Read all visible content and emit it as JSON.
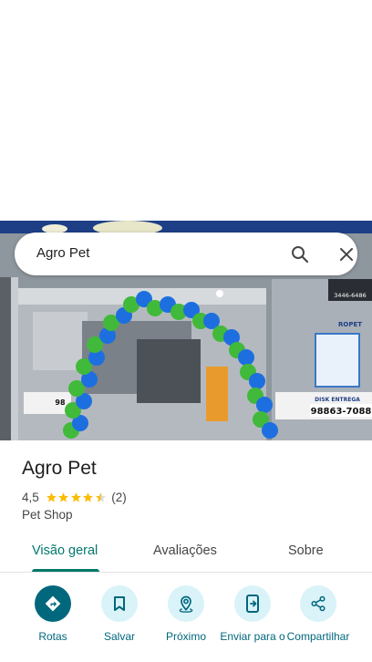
{
  "search": {
    "query": "Agro Pet"
  },
  "place": {
    "name": "Agro Pet",
    "rating": "4,5",
    "review_count": "(2)",
    "category": "Pet Shop",
    "stars_value": 4.5
  },
  "photo": {
    "signs": {
      "disk_entrega": "DISK ENTREGA",
      "phone_right": "98863-7088",
      "phone_left": "98",
      "phone_top": "3446-6486",
      "agropet_tag": "ROPET"
    }
  },
  "tabs": [
    {
      "label": "Visão geral",
      "active": true
    },
    {
      "label": "Avaliações",
      "active": false
    },
    {
      "label": "Sobre",
      "active": false
    }
  ],
  "actions": [
    {
      "label": "Rotas",
      "icon": "directions-icon"
    },
    {
      "label": "Salvar",
      "icon": "bookmark-icon"
    },
    {
      "label": "Próximo",
      "icon": "nearby-icon"
    },
    {
      "label": "Enviar para o",
      "icon": "send-to-phone-icon"
    },
    {
      "label": "Compartilhar",
      "icon": "share-icon"
    }
  ],
  "colors": {
    "accent": "#00796b",
    "action_primary": "#00677d",
    "action_tint": "#d9f3f8",
    "star": "#fbbc04"
  }
}
